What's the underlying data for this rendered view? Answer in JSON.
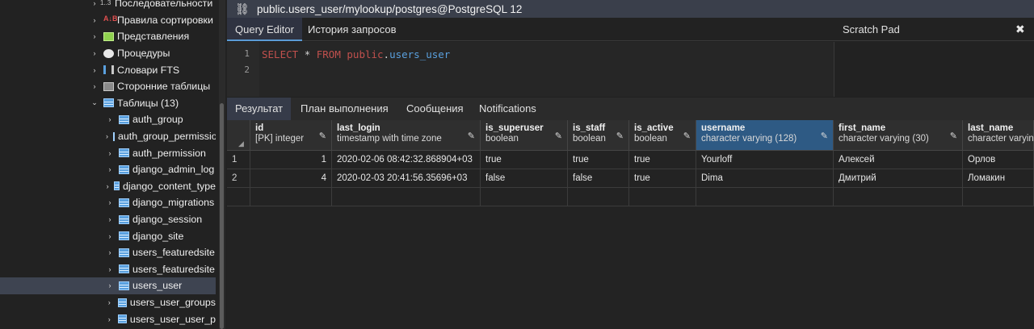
{
  "tree": {
    "items": [
      {
        "label": "Последовательности",
        "icon": "sequence-icon",
        "icon_text": "1..3",
        "caret": "›",
        "level": 1
      },
      {
        "label": "Правила сортировки",
        "icon": "collation-icon",
        "icon_text": "A↓B",
        "caret": "›",
        "level": 1
      },
      {
        "label": "Представления",
        "icon": "view-icon",
        "caret": "›",
        "level": 1
      },
      {
        "label": "Процедуры",
        "icon": "procedure-icon",
        "caret": "›",
        "level": 1
      },
      {
        "label": "Словари FTS",
        "icon": "fts-dictionary-icon",
        "caret": "›",
        "level": 1
      },
      {
        "label": "Сторонние таблицы",
        "icon": "foreign-table-icon",
        "caret": "›",
        "level": 1
      },
      {
        "label": "Таблицы (13)",
        "icon": "tables-icon",
        "caret": "⌄",
        "level": 1
      },
      {
        "label": "auth_group",
        "icon": "table-icon",
        "caret": "›",
        "level": 2
      },
      {
        "label": "auth_group_permissions",
        "icon": "table-icon",
        "caret": "›",
        "level": 2
      },
      {
        "label": "auth_permission",
        "icon": "table-icon",
        "caret": "›",
        "level": 2
      },
      {
        "label": "django_admin_log",
        "icon": "table-icon",
        "caret": "›",
        "level": 2
      },
      {
        "label": "django_content_type",
        "icon": "table-icon",
        "caret": "›",
        "level": 2
      },
      {
        "label": "django_migrations",
        "icon": "table-icon",
        "caret": "›",
        "level": 2
      },
      {
        "label": "django_session",
        "icon": "table-icon",
        "caret": "›",
        "level": 2
      },
      {
        "label": "django_site",
        "icon": "table-icon",
        "caret": "›",
        "level": 2
      },
      {
        "label": "users_featuredsite",
        "icon": "table-icon",
        "caret": "›",
        "level": 2
      },
      {
        "label": "users_featuredsite",
        "icon": "table-icon",
        "caret": "›",
        "level": 2
      },
      {
        "label": "users_user",
        "icon": "table-icon",
        "caret": "›",
        "level": 2,
        "selected": true
      },
      {
        "label": "users_user_groups",
        "icon": "table-icon",
        "caret": "›",
        "level": 2
      },
      {
        "label": "users_user_user_p",
        "icon": "table-icon",
        "caret": "›",
        "level": 2
      }
    ]
  },
  "titlebar": {
    "title": "public.users_user/mylookup/postgres@PostgreSQL 12",
    "icon": "connection-icon"
  },
  "editor_tabs": {
    "query_editor": "Query Editor",
    "history": "История запросов",
    "scratch_pad": "Scratch Pad",
    "close": "✖"
  },
  "editor": {
    "line_numbers": [
      "1",
      "2"
    ],
    "code": {
      "select": "SELECT",
      "star": "*",
      "from": "FROM",
      "schema": "public",
      "dot": ".",
      "table": "users_user"
    }
  },
  "result_tabs": {
    "result": "Результат",
    "plan": "План выполнения",
    "messages": "Сообщения",
    "notifications": "Notifications"
  },
  "grid": {
    "columns": [
      {
        "name": "id",
        "type": "[PK] integer"
      },
      {
        "name": "last_login",
        "type": "timestamp with time zone"
      },
      {
        "name": "is_superuser",
        "type": "boolean"
      },
      {
        "name": "is_staff",
        "type": "boolean"
      },
      {
        "name": "is_active",
        "type": "boolean"
      },
      {
        "name": "username",
        "type": "character varying (128)"
      },
      {
        "name": "first_name",
        "type": "character varying (30)"
      },
      {
        "name": "last_name",
        "type": "character varying"
      }
    ],
    "rows": [
      {
        "n": "1",
        "cells": [
          "1",
          "2020-02-06 08:42:32.868904+03",
          "true",
          "true",
          "true",
          "Yourloff",
          "Алексей",
          "Орлов"
        ]
      },
      {
        "n": "2",
        "cells": [
          "4",
          "2020-02-03 20:41:56.35696+03",
          "false",
          "false",
          "true",
          "Dima",
          "Дмитрий",
          "Ломакин"
        ]
      }
    ]
  }
}
